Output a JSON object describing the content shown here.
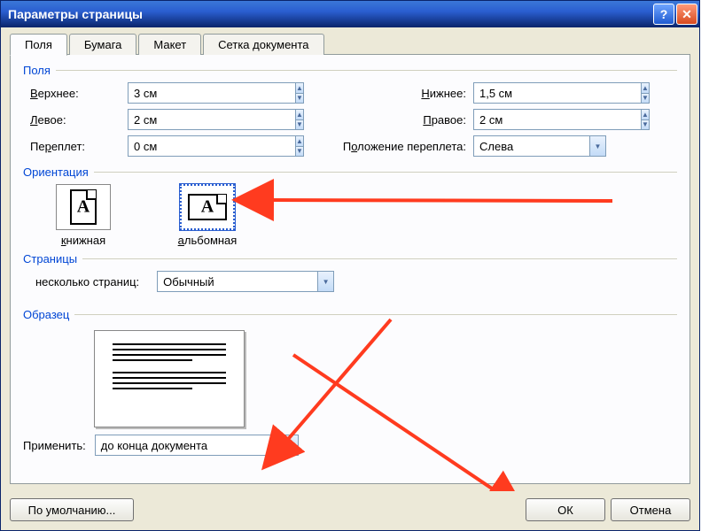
{
  "window": {
    "title": "Параметры страницы"
  },
  "tabs": {
    "fields": "Поля",
    "paper": "Бумага",
    "layout": "Макет",
    "docgrid": "Сетка документа"
  },
  "sections": {
    "margins": "Поля",
    "orientation": "Ориентация",
    "pages": "Страницы",
    "preview": "Образец"
  },
  "margins": {
    "top_label": "Верхнее:",
    "top_value": "3 см",
    "bottom_label": "Нижнее:",
    "bottom_value": "1,5 см",
    "left_label": "Левое:",
    "left_value": "2 см",
    "right_label": "Правое:",
    "right_value": "2 см",
    "gutter_label": "Переплет:",
    "gutter_value": "0 см",
    "gutter_pos_label": "Положение переплета:",
    "gutter_pos_value": "Слева"
  },
  "orientation": {
    "portrait_label": "книжная",
    "landscape_label": "альбомная"
  },
  "pages": {
    "multi_label": "несколько страниц:",
    "multi_value": "Обычный"
  },
  "apply": {
    "label": "Применить:",
    "value": "до конца документа"
  },
  "buttons": {
    "default": "По умолчанию...",
    "ok": "ОК",
    "cancel": "Отмена"
  }
}
